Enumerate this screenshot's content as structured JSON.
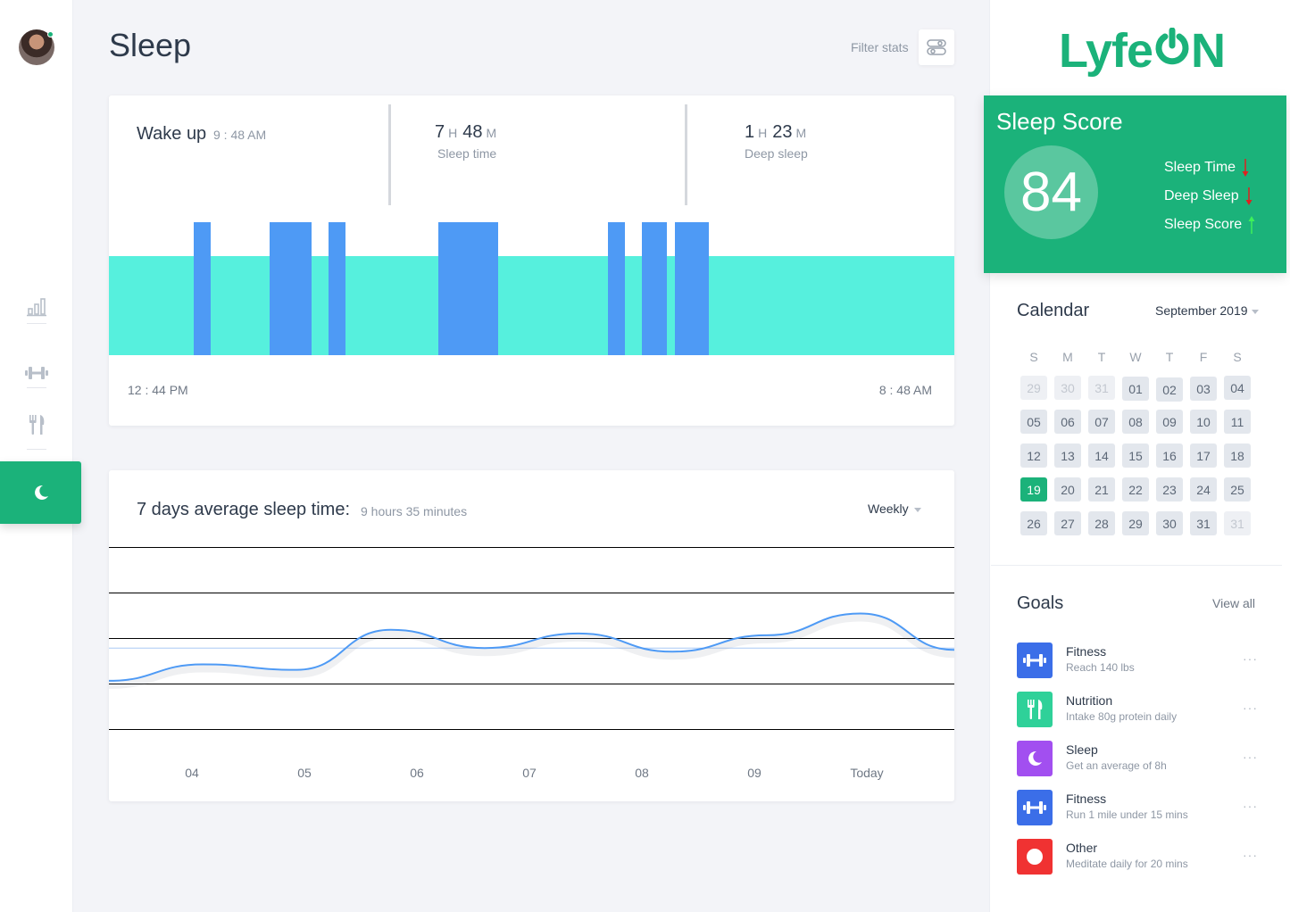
{
  "nav": {
    "items": [
      "stats-icon",
      "fitness-icon",
      "nutrition-icon",
      "sleep-icon"
    ],
    "active": "sleep"
  },
  "page": {
    "title": "Sleep",
    "filter_label": "Filter stats"
  },
  "summary": {
    "wake_label": "Wake up",
    "wake_time": "9 : 48 AM",
    "sleep_time": {
      "hours": "7",
      "h_unit": "H",
      "minutes": "48",
      "m_unit": "M",
      "caption": "Sleep time"
    },
    "deep_sleep": {
      "hours": "1",
      "h_unit": "H",
      "minutes": "23",
      "m_unit": "M",
      "caption": "Deep sleep"
    },
    "start_time": "12 : 44 PM",
    "end_time": "8 : 48 AM",
    "colors": {
      "light_sleep": "#56f0dd",
      "deep_sleep": "#4e9af5"
    }
  },
  "average": {
    "label": "7 days average sleep time:",
    "value": "9 hours 35 minutes",
    "period": "Weekly"
  },
  "chart_data": [
    {
      "type": "bar",
      "title": "",
      "xlabel": "",
      "ylabel": "",
      "x_start": "12 : 44 PM",
      "x_end": "8 : 48 AM",
      "series": [
        {
          "name": "",
          "segments": [
            [
              0,
              1
            ]
          ]
        },
        {
          "name": "",
          "segments": [
            [
              0.1,
              0.12
            ],
            [
              0.19,
              0.24
            ],
            [
              0.26,
              0.28
            ],
            [
              0.39,
              0.46
            ],
            [
              0.59,
              0.61
            ],
            [
              0.63,
              0.66
            ],
            [
              0.67,
              0.71
            ]
          ]
        }
      ]
    },
    {
      "type": "line",
      "title": "",
      "categories": [
        "04",
        "05",
        "06",
        "07",
        "08",
        "09",
        "Today"
      ],
      "series": [
        {
          "name": "",
          "values": [
            0.27,
            0.36,
            0.33,
            0.55,
            0.45,
            0.53,
            0.43,
            0.52,
            0.64,
            0.44
          ]
        }
      ],
      "average_line": 0.45,
      "ylim": [
        0,
        1
      ],
      "grid": true,
      "line_color": "#4e9af5"
    }
  ],
  "brand": {
    "name_prefix": "Lyfe",
    "name_suffix": "N",
    "color": "#1bb27a"
  },
  "sleep_score": {
    "title": "Sleep Score",
    "value": "84",
    "items": [
      {
        "label": "Sleep Time",
        "trend": "down"
      },
      {
        "label": "Deep Sleep",
        "trend": "down"
      },
      {
        "label": "Sleep Score",
        "trend": "up"
      }
    ]
  },
  "calendar": {
    "title": "Calendar",
    "month": "September 2019",
    "weekdays": [
      "S",
      "M",
      "T",
      "W",
      "T",
      "F",
      "S"
    ],
    "weeks": [
      [
        "29",
        "30",
        "31",
        "01",
        "02",
        "03",
        "04"
      ],
      [
        "05",
        "06",
        "07",
        "08",
        "09",
        "10",
        "11"
      ],
      [
        "12",
        "13",
        "14",
        "15",
        "16",
        "17",
        "18"
      ],
      [
        "19",
        "20",
        "21",
        "22",
        "23",
        "24",
        "25"
      ],
      [
        "26",
        "27",
        "28",
        "29",
        "30",
        "31",
        "31"
      ]
    ],
    "muted": [
      [
        0,
        0
      ],
      [
        0,
        1
      ],
      [
        0,
        2
      ],
      [
        4,
        6
      ]
    ],
    "selected": [
      3,
      0
    ]
  },
  "goals": {
    "title": "Goals",
    "view_all": "View all",
    "more": "···",
    "items": [
      {
        "name": "Fitness",
        "sub": "Reach 140 lbs",
        "icon": "dumbbell-icon",
        "color": "#3b6ee8"
      },
      {
        "name": "Nutrition",
        "sub": "Intake 80g protein daily",
        "icon": "fork-knife-icon",
        "color": "#2fd199"
      },
      {
        "name": "Sleep",
        "sub": "Get an average of 8h",
        "icon": "moon-icon",
        "color": "#a24ff0"
      },
      {
        "name": "Fitness",
        "sub": "Run 1 mile under 15 mins",
        "icon": "dumbbell-icon",
        "color": "#3b6ee8"
      },
      {
        "name": "Other",
        "sub": "Meditate daily for 20 mins",
        "icon": "circle-icon",
        "color": "#f03232"
      }
    ]
  }
}
